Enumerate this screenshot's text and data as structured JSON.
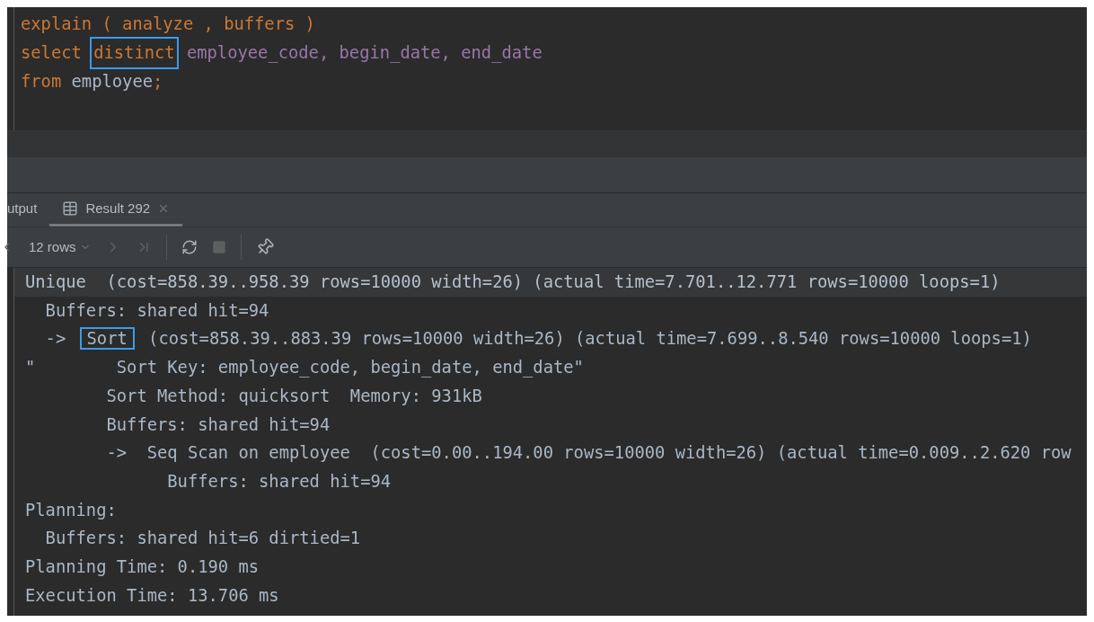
{
  "editor": {
    "lines": [
      {
        "tokens": [
          {
            "text": "explain ( analyze , buffers )",
            "kind": "keyword",
            "highlighted": false
          }
        ]
      },
      {
        "tokens": [
          {
            "text": "select ",
            "kind": "keyword",
            "highlighted": false
          },
          {
            "text": "distinct",
            "kind": "keyword",
            "highlighted": true
          },
          {
            "text": " employee_code, begin_date, end_date",
            "kind": "column",
            "highlighted": false
          }
        ]
      },
      {
        "tokens": [
          {
            "text": "from ",
            "kind": "keyword",
            "highlighted": false
          },
          {
            "text": "employee",
            "kind": "ident",
            "highlighted": false
          },
          {
            "text": ";",
            "kind": "keyword",
            "highlighted": false
          }
        ]
      }
    ]
  },
  "tabs": [
    {
      "label": "utput",
      "selected": false,
      "closable": false
    },
    {
      "label": "Result 292",
      "selected": true,
      "closable": true
    }
  ],
  "toolbar": {
    "rows_label": "12 rows"
  },
  "result": {
    "lines": [
      {
        "selected": true,
        "segments": [
          {
            "text": "Unique  (cost=858.39..958.39 rows=10000 width=26) (actual time=7.701..12.771 rows=10000 loops=1)",
            "highlighted": false
          }
        ]
      },
      {
        "selected": false,
        "segments": [
          {
            "text": "  Buffers: shared hit=94",
            "highlighted": false
          }
        ]
      },
      {
        "selected": false,
        "segments": [
          {
            "text": "  -> ",
            "highlighted": false
          },
          {
            "text": "Sort",
            "highlighted": true
          },
          {
            "text": " (cost=858.39..883.39 rows=10000 width=26) (actual time=7.699..8.540 rows=10000 loops=1)",
            "highlighted": false
          }
        ]
      },
      {
        "selected": false,
        "segments": [
          {
            "text": "\"        Sort Key: employee_code, begin_date, end_date\"",
            "highlighted": false
          }
        ]
      },
      {
        "selected": false,
        "segments": [
          {
            "text": "        Sort Method: quicksort  Memory: 931kB",
            "highlighted": false
          }
        ]
      },
      {
        "selected": false,
        "segments": [
          {
            "text": "        Buffers: shared hit=94",
            "highlighted": false
          }
        ]
      },
      {
        "selected": false,
        "segments": [
          {
            "text": "        ->  Seq Scan on employee  (cost=0.00..194.00 rows=10000 width=26) (actual time=0.009..2.620 row",
            "highlighted": false
          }
        ]
      },
      {
        "selected": false,
        "segments": [
          {
            "text": "              Buffers: shared hit=94",
            "highlighted": false
          }
        ]
      },
      {
        "selected": false,
        "segments": [
          {
            "text": "Planning:",
            "highlighted": false
          }
        ]
      },
      {
        "selected": false,
        "segments": [
          {
            "text": "  Buffers: shared hit=6 dirtied=1",
            "highlighted": false
          }
        ]
      },
      {
        "selected": false,
        "segments": [
          {
            "text": "Planning Time: 0.190 ms",
            "highlighted": false
          }
        ]
      },
      {
        "selected": false,
        "segments": [
          {
            "text": "Execution Time: 13.706 ms",
            "highlighted": false
          }
        ]
      }
    ]
  }
}
